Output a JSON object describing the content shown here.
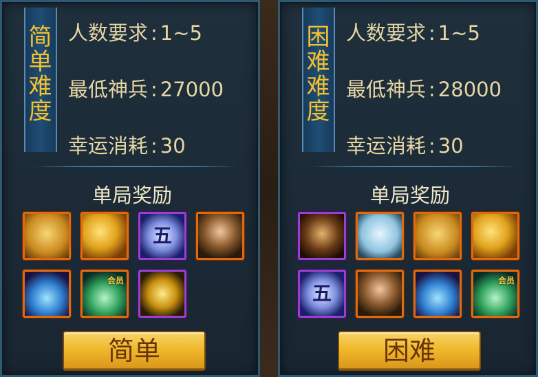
{
  "colors": {
    "panel_bg": "#1c2b37",
    "panel_border": "#2f5a73",
    "badge_text": "#f6c12b",
    "info_text": "#e7d7a6",
    "orange_frame": "#e06a10",
    "purple_frame": "#9a3fd0",
    "button_gold": "#f0b92c"
  },
  "panels": [
    {
      "badge": "简单难度",
      "rows": [
        {
          "label": "人数要求",
          "value": "1~5"
        },
        {
          "label": "最低神兵",
          "value": "27000"
        },
        {
          "label": "幸运消耗",
          "value": "30"
        }
      ],
      "reward_title": "单局奖励",
      "rewards": [
        {
          "icon": "gold-scroll-icon",
          "frame": "orange",
          "tag": ""
        },
        {
          "icon": "gold-coins-icon",
          "frame": "orange",
          "tag": ""
        },
        {
          "icon": "wu-rune-icon",
          "frame": "purple",
          "tag": ""
        },
        {
          "icon": "hero-portrait-icon",
          "frame": "orange",
          "tag": ""
        },
        {
          "icon": "blue-pouch-icon",
          "frame": "orange",
          "tag": ""
        },
        {
          "icon": "green-pouch-icon",
          "frame": "orange",
          "tag": "会员"
        },
        {
          "icon": "golden-mask-icon",
          "frame": "purple",
          "tag": ""
        }
      ],
      "button": "简单"
    },
    {
      "badge": "困难难度",
      "rows": [
        {
          "label": "人数要求",
          "value": "1~5"
        },
        {
          "label": "最低神兵",
          "value": "28000"
        },
        {
          "label": "幸运消耗",
          "value": "30"
        }
      ],
      "reward_title": "单局奖励",
      "rewards": [
        {
          "icon": "warrior-card-icon",
          "frame": "purple",
          "tag": ""
        },
        {
          "icon": "blue-scroll-icon",
          "frame": "orange",
          "tag": ""
        },
        {
          "icon": "gold-scroll-icon",
          "frame": "orange",
          "tag": ""
        },
        {
          "icon": "gold-coins-icon",
          "frame": "orange",
          "tag": ""
        },
        {
          "icon": "wu-rune-icon",
          "frame": "purple",
          "tag": ""
        },
        {
          "icon": "hero-portrait-icon",
          "frame": "orange",
          "tag": ""
        },
        {
          "icon": "blue-pouch-icon",
          "frame": "orange",
          "tag": ""
        },
        {
          "icon": "green-pouch-icon",
          "frame": "orange",
          "tag": "会员"
        }
      ],
      "button": "困难"
    }
  ],
  "wu_glyph": "五"
}
